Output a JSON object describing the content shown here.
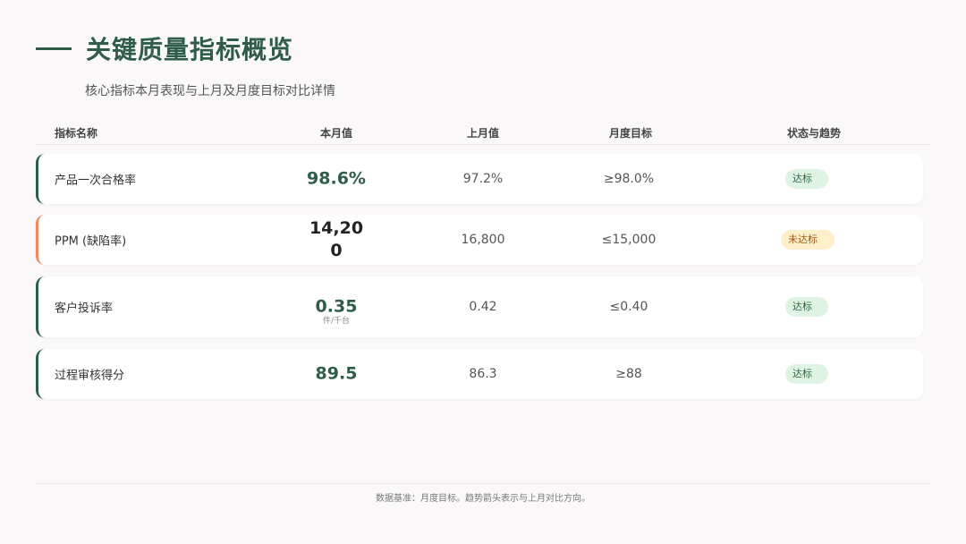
{
  "header": {
    "title": "关键质量指标概览",
    "subtitle": "核心指标本月表现与上月及月度目标对比详情"
  },
  "table": {
    "columns": [
      "指标名称",
      "本月值",
      "上月值",
      "月度目标",
      "状态与趋势"
    ],
    "rows": [
      {
        "name": "产品一次合格率",
        "current": "98.6%",
        "unit": "",
        "last": "97.2%",
        "target": "≥98.0%",
        "status": "达标",
        "status_type": "ok",
        "accent": "#2f5d48"
      },
      {
        "name": "PPM (缺陷率)",
        "current": "14,200",
        "unit": "",
        "last": "16,800",
        "target": "≤15,000",
        "status": "未达标",
        "status_type": "bad",
        "accent": "#f08a5d"
      },
      {
        "name": "客户投诉率",
        "current": "0.35",
        "unit": "件/千台",
        "last": "0.42",
        "target": "≤0.40",
        "status": "达标",
        "status_type": "ok",
        "accent": "#2f5d48"
      },
      {
        "name": "过程审核得分",
        "current": "89.5",
        "unit": "",
        "last": "86.3",
        "target": "≥88",
        "status": "达标",
        "status_type": "ok",
        "accent": "#2f5d48"
      }
    ]
  },
  "footer": {
    "note": "数据基准：月度目标。趋势箭头表示与上月对比方向。"
  },
  "colors": {
    "brand_green": "#2f5d48",
    "warn_orange": "#f08a5d",
    "ok_badge_bg": "#dff3e5",
    "bad_badge_bg": "#fdf0c9"
  }
}
